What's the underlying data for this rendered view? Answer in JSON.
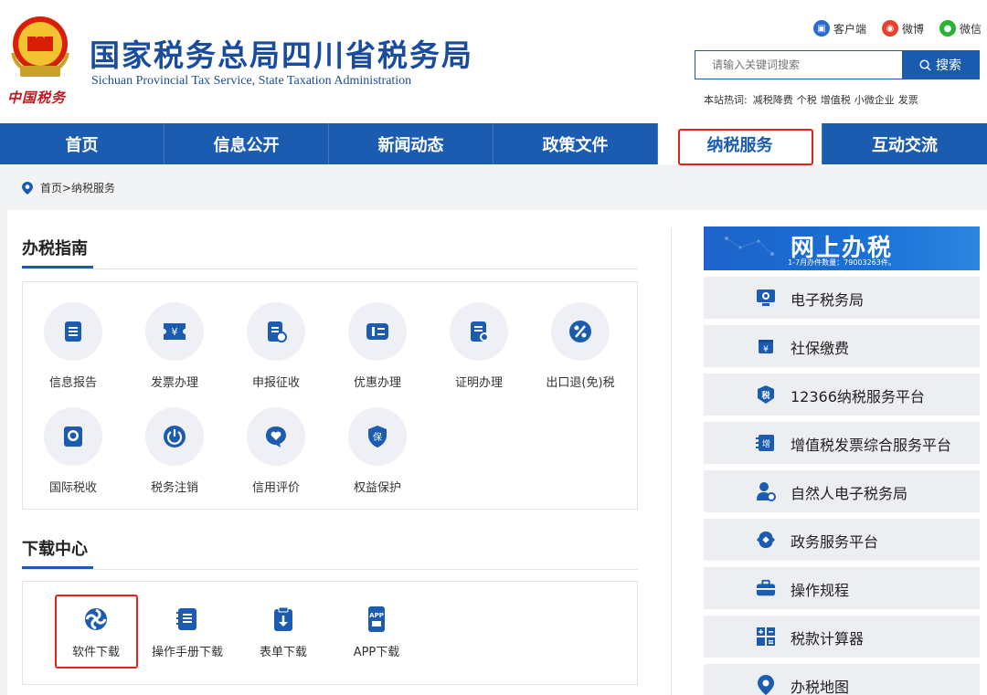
{
  "header": {
    "title": "国家税务总局四川省税务局",
    "subtitle": "Sichuan Provincial Tax Service, State Taxation Administration",
    "seal_text": "中国税务",
    "social": [
      {
        "label": "客户端",
        "icon": "client-icon"
      },
      {
        "label": "微博",
        "icon": "weibo-icon"
      },
      {
        "label": "微信",
        "icon": "wechat-icon"
      }
    ],
    "search": {
      "placeholder": "请输入关键词搜索",
      "button": "搜索"
    },
    "hot": {
      "label": "本站热词:",
      "words": [
        "减税降费",
        "个税",
        "增值税",
        "小微企业",
        "发票"
      ]
    }
  },
  "nav": {
    "items": [
      "首页",
      "信息公开",
      "新闻动态",
      "政策文件",
      "纳税服务",
      "互动交流"
    ],
    "active": "纳税服务"
  },
  "breadcrumb": "首页>纳税服务",
  "guide": {
    "title": "办税指南",
    "items": [
      {
        "label": "信息报告",
        "icon": "document-icon"
      },
      {
        "label": "发票办理",
        "icon": "yuan-ticket-icon"
      },
      {
        "label": "申报征收",
        "icon": "declare-icon"
      },
      {
        "label": "优惠办理",
        "icon": "discount-card-icon"
      },
      {
        "label": "证明办理",
        "icon": "certificate-icon"
      },
      {
        "label": "出口退(免)税",
        "icon": "percent-icon"
      },
      {
        "label": "国际税收",
        "icon": "globe-icon"
      },
      {
        "label": "税务注销",
        "icon": "power-icon"
      },
      {
        "label": "信用评价",
        "icon": "heart-chat-icon"
      },
      {
        "label": "权益保护",
        "icon": "shield-icon"
      }
    ]
  },
  "download": {
    "title": "下载中心",
    "items": [
      {
        "label": "软件下载",
        "icon": "software-icon"
      },
      {
        "label": "操作手册下载",
        "icon": "manual-icon"
      },
      {
        "label": "表单下载",
        "icon": "form-download-icon"
      },
      {
        "label": "APP下载",
        "icon": "app-icon"
      }
    ]
  },
  "sidebar": {
    "banner_title": "网上办税",
    "banner_sub": "1-7月办件数量：79003263件。",
    "items": [
      {
        "label": "电子税务局",
        "icon": "monitor-icon"
      },
      {
        "label": "社保缴费",
        "icon": "wallet-icon"
      },
      {
        "label": "12366纳税服务平台",
        "icon": "service-badge-icon"
      },
      {
        "label": "增值税发票综合服务平台",
        "icon": "invoice-platform-icon"
      },
      {
        "label": "自然人电子税务局",
        "icon": "person-icon"
      },
      {
        "label": "政务服务平台",
        "icon": "gov-service-icon"
      },
      {
        "label": "操作规程",
        "icon": "briefcase-icon"
      },
      {
        "label": "税款计算器",
        "icon": "calculator-icon"
      },
      {
        "label": "办税地图",
        "icon": "map-pin-icon"
      }
    ]
  },
  "colors": {
    "brand": "#1b5cb1",
    "highlight": "#e2231a",
    "seal": "#c0161d"
  }
}
